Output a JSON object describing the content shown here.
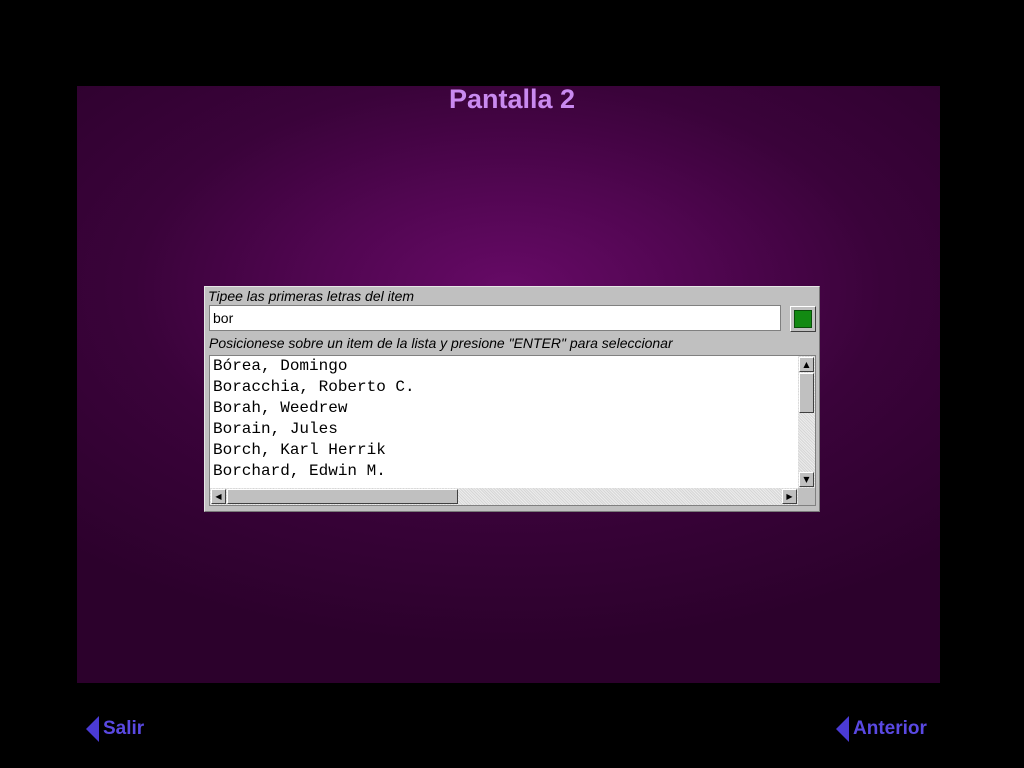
{
  "page": {
    "title": "Pantalla 2"
  },
  "dialog": {
    "first_label": "Tipee las primeras letras del item",
    "search_value": "bor",
    "second_label": "Posicionese sobre un item de la lista y presione \"ENTER\" para seleccionar",
    "items": [
      "Bórea, Domingo",
      "Boracchia, Roberto C.",
      "Borah, Weedrew",
      "Borain, Jules",
      "Borch, Karl Herrik",
      "Borchard, Edwin M."
    ],
    "scroll_up_glyph": "▲",
    "scroll_down_glyph": "▼",
    "scroll_left_glyph": "◀",
    "scroll_right_glyph": "▶",
    "go_button_color": "#128a12"
  },
  "nav": {
    "exit_label": "Salir",
    "previous_label": "Anterior",
    "icon": "left-triangle-icon",
    "accent": "#5a49e3"
  },
  "colors": {
    "background": "#000000",
    "stage": "#520652",
    "title": "#c98af0",
    "dialog": "#c0c0c0"
  }
}
